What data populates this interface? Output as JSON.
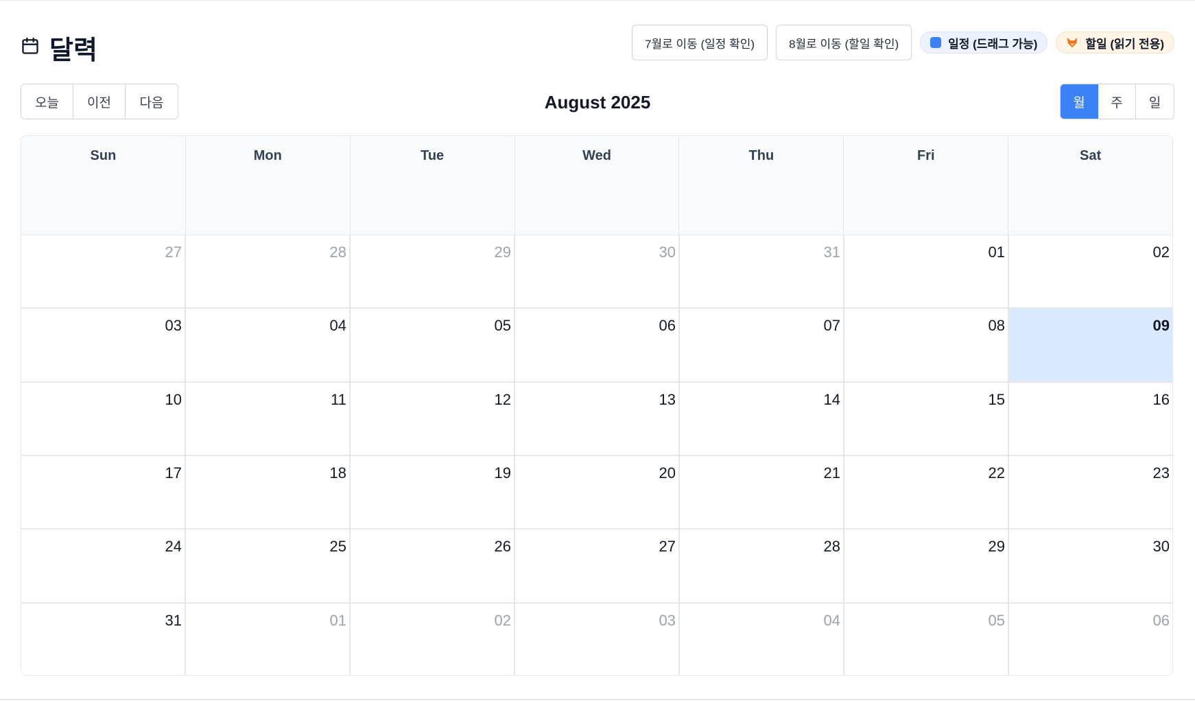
{
  "header": {
    "title": "달력",
    "buttons": {
      "july": "7월로 이동 (일정 확인)",
      "august": "8월로 이동 (할일 확인)"
    },
    "legend": {
      "events": "일정 (드래그 가능)",
      "todos": "할일 (읽기 전용)"
    }
  },
  "toolbar": {
    "today": "오늘",
    "prev": "이전",
    "next": "다음",
    "month_title": "August 2025",
    "views": {
      "month": "월",
      "week": "주",
      "day": "일",
      "active": "월"
    }
  },
  "calendar": {
    "weekdays": [
      "Sun",
      "Mon",
      "Tue",
      "Wed",
      "Thu",
      "Fri",
      "Sat"
    ],
    "today": "09",
    "weeks": [
      [
        {
          "d": "27",
          "other": true
        },
        {
          "d": "28",
          "other": true
        },
        {
          "d": "29",
          "other": true
        },
        {
          "d": "30",
          "other": true
        },
        {
          "d": "31",
          "other": true
        },
        {
          "d": "01"
        },
        {
          "d": "02"
        }
      ],
      [
        {
          "d": "03"
        },
        {
          "d": "04"
        },
        {
          "d": "05"
        },
        {
          "d": "06"
        },
        {
          "d": "07"
        },
        {
          "d": "08"
        },
        {
          "d": "09",
          "today": true
        }
      ],
      [
        {
          "d": "10"
        },
        {
          "d": "11"
        },
        {
          "d": "12"
        },
        {
          "d": "13"
        },
        {
          "d": "14"
        },
        {
          "d": "15"
        },
        {
          "d": "16"
        }
      ],
      [
        {
          "d": "17"
        },
        {
          "d": "18"
        },
        {
          "d": "19"
        },
        {
          "d": "20"
        },
        {
          "d": "21"
        },
        {
          "d": "22"
        },
        {
          "d": "23"
        }
      ],
      [
        {
          "d": "24"
        },
        {
          "d": "25"
        },
        {
          "d": "26"
        },
        {
          "d": "27"
        },
        {
          "d": "28"
        },
        {
          "d": "29"
        },
        {
          "d": "30"
        }
      ],
      [
        {
          "d": "31"
        },
        {
          "d": "01",
          "other": true
        },
        {
          "d": "02",
          "other": true
        },
        {
          "d": "03",
          "other": true
        },
        {
          "d": "04",
          "other": true
        },
        {
          "d": "05",
          "other": true
        },
        {
          "d": "06",
          "other": true
        }
      ]
    ]
  },
  "colors": {
    "accent": "#3b82f6",
    "today_bg": "#dbeafe",
    "event_legend": "#3b82f6",
    "todo_legend": "#f97316"
  },
  "icons": {
    "title": "calendar-icon",
    "events_legend": "blue-square-icon",
    "todos_legend": "fox-icon"
  }
}
